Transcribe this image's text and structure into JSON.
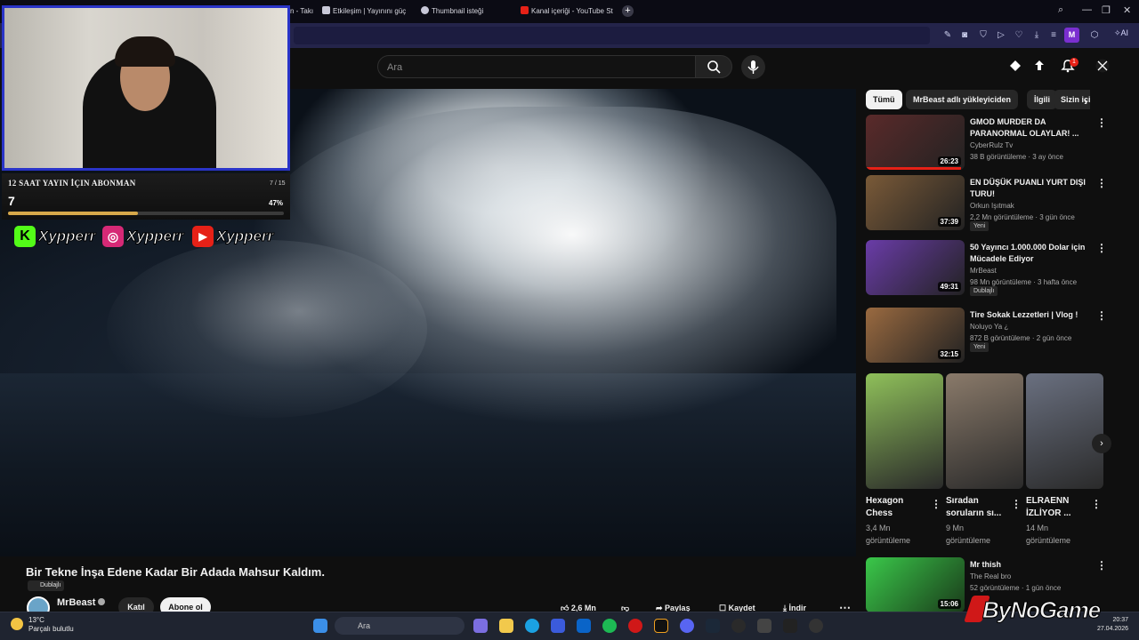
{
  "browser": {
    "tabs": [
      {
        "label": "n - Takı",
        "color": "#4a4a58"
      },
      {
        "label": "Etkileşim | Yayınını güç",
        "color": "#c8c8d8"
      },
      {
        "label": "Thumbnail isteği",
        "color": "#c8c8d8"
      },
      {
        "label": "Kanal içeriği - YouTube St",
        "color": "#e62117"
      }
    ],
    "new_tab": "+",
    "avatar_letter": "M",
    "ai_label": "AI"
  },
  "youtube": {
    "search_placeholder": "Ara",
    "notification_count": "1"
  },
  "stream_overlay": {
    "goal_title": "12 SAAT YAYIN İÇIN ABONMAN",
    "goal_count": "7 / 15",
    "goal_value": "7",
    "goal_percent": "47%",
    "goal_fraction": 0.47,
    "socials": [
      {
        "icon": "kick-icon",
        "letter": "K",
        "handle": "Xypperr",
        "color": "#53fc18"
      },
      {
        "icon": "instagram-icon",
        "letter": "◎",
        "handle": "Xypperr",
        "color": "#d62976"
      },
      {
        "icon": "youtube-icon",
        "letter": "▶",
        "handle": "Xypperr",
        "color": "#e62117"
      }
    ]
  },
  "video": {
    "title": "Bir Tekne İnşa Edene Kadar Bir Adada Mahsur Kaldım.",
    "dub_badge": "Dublajlı",
    "channel": "MrBeast",
    "join_label": "Katıl",
    "subscribe_label": "Abone ol",
    "likes": "2,6 Mn",
    "share_label": "Paylaş",
    "save_label": "Kaydet",
    "download_label": "İndir",
    "more": "⋯"
  },
  "chips": [
    "Tümü",
    "MrBeast adlı yükleyiciden",
    "İlgili",
    "Sizin için"
  ],
  "recommendations": [
    {
      "title": "GMOD MURDER DA PARANORMAL OLAYLAR! ...",
      "channel": "CyberRulz Tv",
      "meta": "38 B görüntüleme · 3 ay önce",
      "duration": "26:23",
      "badge": "",
      "watched": 0.96,
      "thumb": "#5a2a2a"
    },
    {
      "title": "EN DÜŞÜK PUANLI YURT DIŞI TURU!",
      "channel": "Orkun Işıtmak",
      "meta": "2,2 Mn görüntüleme · 3 gün önce",
      "duration": "37:39",
      "badge": "Yeni",
      "watched": 0,
      "thumb": "#7a5a38"
    },
    {
      "title": "50 Yayıncı 1.000.000 Dolar için Mücadele Ediyor",
      "channel": "MrBeast",
      "meta": "98 Mn görüntüleme · 3 hafta önce",
      "duration": "49:31",
      "badge": "Dublajlı",
      "watched": 0,
      "thumb": "#6a3ca8"
    },
    {
      "title": "Tire Sokak Lezzetleri | Vlog !",
      "channel": "Noluyo Ya ¿",
      "meta": "872 B görüntüleme · 2 gün önce",
      "duration": "32:15",
      "badge": "Yeni",
      "watched": 0,
      "thumb": "#9a6a40"
    }
  ],
  "shorts": [
    {
      "title": "Hexagon Chess",
      "views": "3,4 Mn görüntüleme",
      "thumb": "#8fc05a"
    },
    {
      "title": "Sıradan soruların sı...",
      "views": "9 Mn görüntüleme",
      "thumb": "#8a7a6a"
    },
    {
      "title": "ELRAENN İZLİYOR ...",
      "views": "14 Mn görüntüleme",
      "thumb": "#6a7080"
    }
  ],
  "extra_recommendation": {
    "title": "Mr thish",
    "channel": "The Real bro",
    "meta": "52 görüntüleme · 1 gün önce",
    "duration": "15:06",
    "thumb": "#3ac84a"
  },
  "taskbar": {
    "temperature": "13°C",
    "weather": "Parçalı bulutlu",
    "search_placeholder": "Ara",
    "time": "20:37",
    "date": "27.04.2026"
  },
  "watermark": "ByNoGame"
}
